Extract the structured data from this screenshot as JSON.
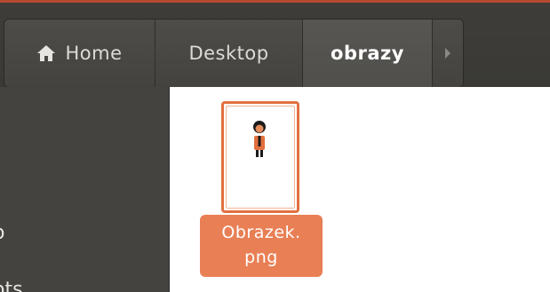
{
  "pathbar": {
    "home_label": "Home",
    "desktop_label": "Desktop",
    "current_label": "obrazy"
  },
  "sidebar": {
    "partial_item_1": "o",
    "partial_item_2": "ots"
  },
  "files": [
    {
      "name_line1": "Obrazek.",
      "name_line2": "png",
      "selected": true
    }
  ],
  "colors": {
    "accent": "#e97f55",
    "toolbar": "#3c3b37",
    "sidebar": "#44433f"
  },
  "icons": {
    "home": "home-icon",
    "next": "chevron-right-icon"
  }
}
